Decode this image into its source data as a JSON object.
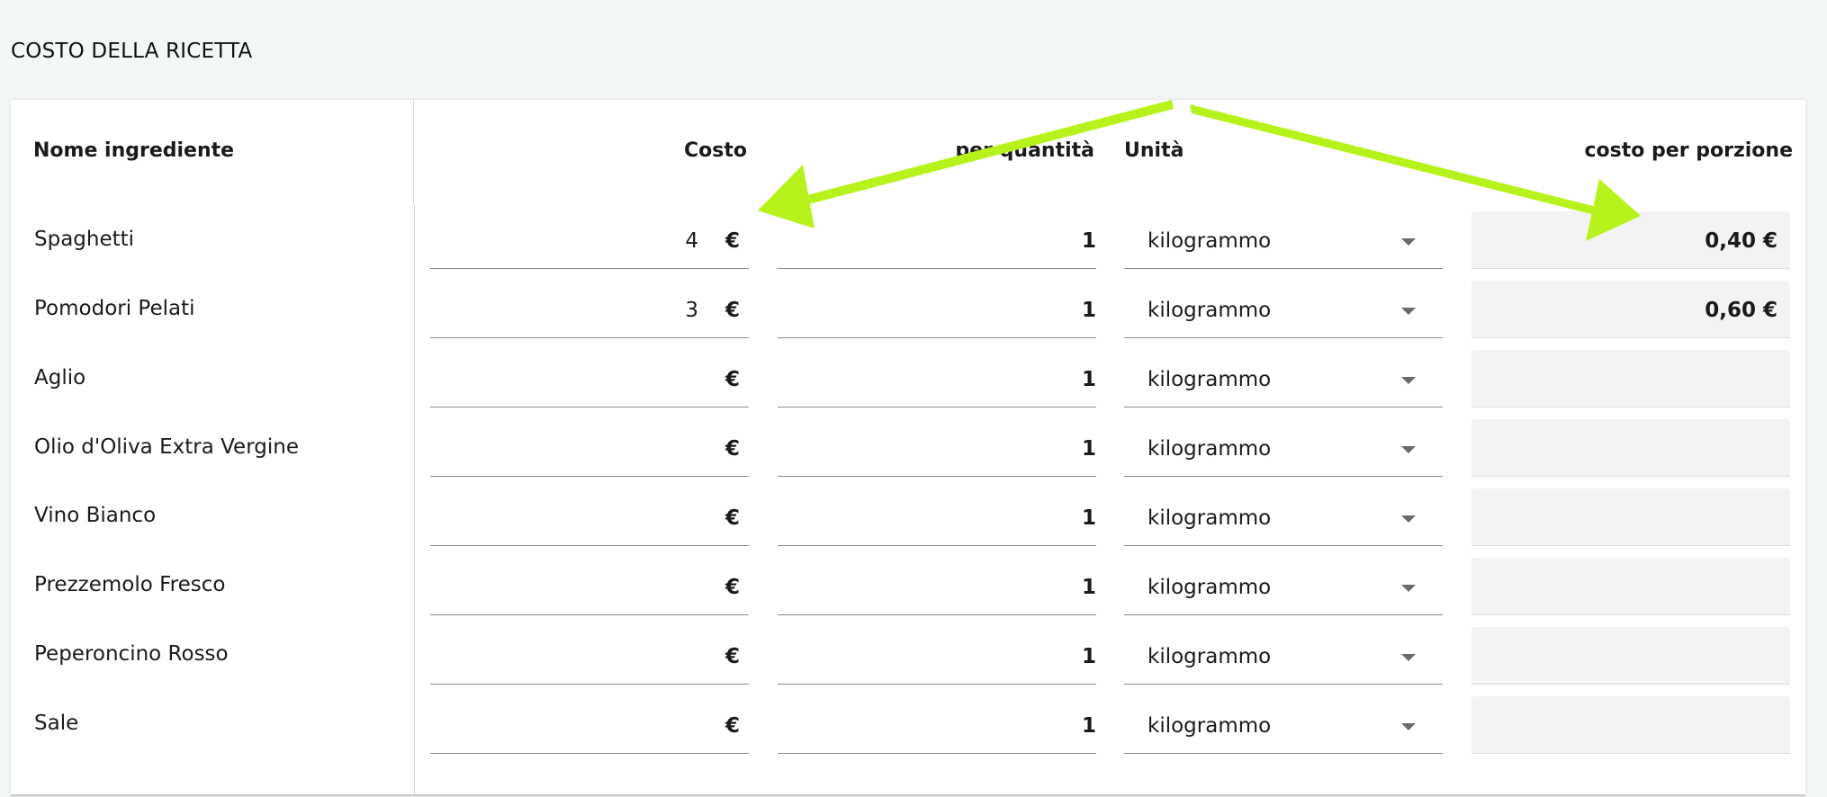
{
  "section_title": "COSTO DELLA RICETTA",
  "table": {
    "headers": {
      "name": "Nome ingrediente",
      "cost": "Costo",
      "quantity": "per quantità",
      "unit": "Unità",
      "portion": "costo per porzione"
    },
    "currency_symbol": "€",
    "rows": [
      {
        "name": "Spaghetti",
        "cost": "4",
        "quantity": "1",
        "unit": "kilogrammo",
        "portion_cost": "0,40 €"
      },
      {
        "name": "Pomodori Pelati",
        "cost": "3",
        "quantity": "1",
        "unit": "kilogrammo",
        "portion_cost": "0,60 €"
      },
      {
        "name": "Aglio",
        "cost": "",
        "quantity": "1",
        "unit": "kilogrammo",
        "portion_cost": ""
      },
      {
        "name": "Olio d'Oliva Extra Vergine",
        "cost": "",
        "quantity": "1",
        "unit": "kilogrammo",
        "portion_cost": ""
      },
      {
        "name": "Vino Bianco",
        "cost": "",
        "quantity": "1",
        "unit": "kilogrammo",
        "portion_cost": ""
      },
      {
        "name": "Prezzemolo Fresco",
        "cost": "",
        "quantity": "1",
        "unit": "kilogrammo",
        "portion_cost": ""
      },
      {
        "name": "Peperoncino Rosso",
        "cost": "",
        "quantity": "1",
        "unit": "kilogrammo",
        "portion_cost": ""
      },
      {
        "name": "Sale",
        "cost": "",
        "quantity": "1",
        "unit": "kilogrammo",
        "portion_cost": ""
      }
    ]
  },
  "colors": {
    "annotation_arrow": "#b8f21c",
    "page_background": "#f4f7f8",
    "readonly_field": "#f3f3f3"
  }
}
